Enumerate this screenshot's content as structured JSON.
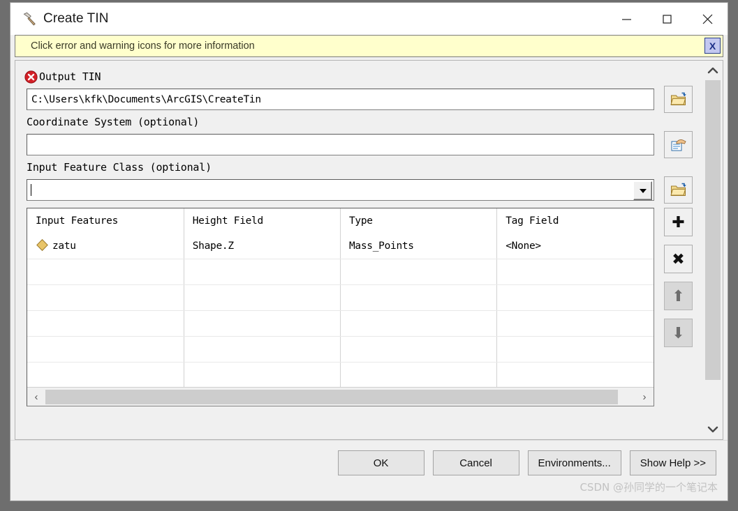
{
  "window": {
    "title": "Create TIN",
    "title_icon": "hammer-icon",
    "minimize_label": "—",
    "maximize_label": "□",
    "close_label": "✕"
  },
  "warning_bar": {
    "message": "Click error and warning icons for more information",
    "close_label": "X",
    "background_color": "#ffffcc"
  },
  "fields": {
    "output_tin": {
      "label": "Output TIN",
      "value": "C:\\Users\\kfk\\Documents\\ArcGIS\\CreateTin",
      "has_error": true,
      "error_color": "#d42027",
      "browse_icon": "open-folder-icon"
    },
    "coordinate_system": {
      "label": "Coordinate System (optional)",
      "value": "",
      "browse_icon": "spatial-reference-icon"
    },
    "input_feature_class": {
      "label": "Input Feature Class (optional)",
      "value": "",
      "browse_icon": "open-folder-icon",
      "dropdown_icon": "chevron-down-icon"
    }
  },
  "table": {
    "columns": [
      "Input Features",
      "Height Field",
      "Type",
      "Tag Field"
    ],
    "rows": [
      {
        "input_features": "zatu",
        "feature_icon": "point-feature-diamond-icon",
        "feature_icon_color": "#e8c468",
        "height_field": "Shape.Z",
        "type": "Mass_Points",
        "tag_field": "<None>"
      }
    ],
    "empty_row_count": 6,
    "hscroll": {
      "left_arrow": "‹",
      "right_arrow": "›"
    }
  },
  "tools": [
    {
      "name": "add-row-button",
      "icon": "plus-icon",
      "glyph": "✚",
      "disabled": false
    },
    {
      "name": "remove-row-button",
      "icon": "cross-icon",
      "glyph": "✖",
      "disabled": false
    },
    {
      "name": "move-up-button",
      "icon": "arrow-up-icon",
      "glyph": "⬆",
      "disabled": true
    },
    {
      "name": "move-down-button",
      "icon": "arrow-down-icon",
      "glyph": "⬇",
      "disabled": true
    }
  ],
  "scrollbar": {
    "up_arrow": "⌃",
    "down_arrow": "⌄"
  },
  "footer": {
    "buttons": [
      {
        "name": "ok-button",
        "label": "OK"
      },
      {
        "name": "cancel-button",
        "label": "Cancel"
      },
      {
        "name": "environments-button",
        "label": "Environments..."
      },
      {
        "name": "show-help-button",
        "label": "Show Help >>"
      }
    ],
    "watermark": "CSDN @孙同学的一个笔记本"
  }
}
